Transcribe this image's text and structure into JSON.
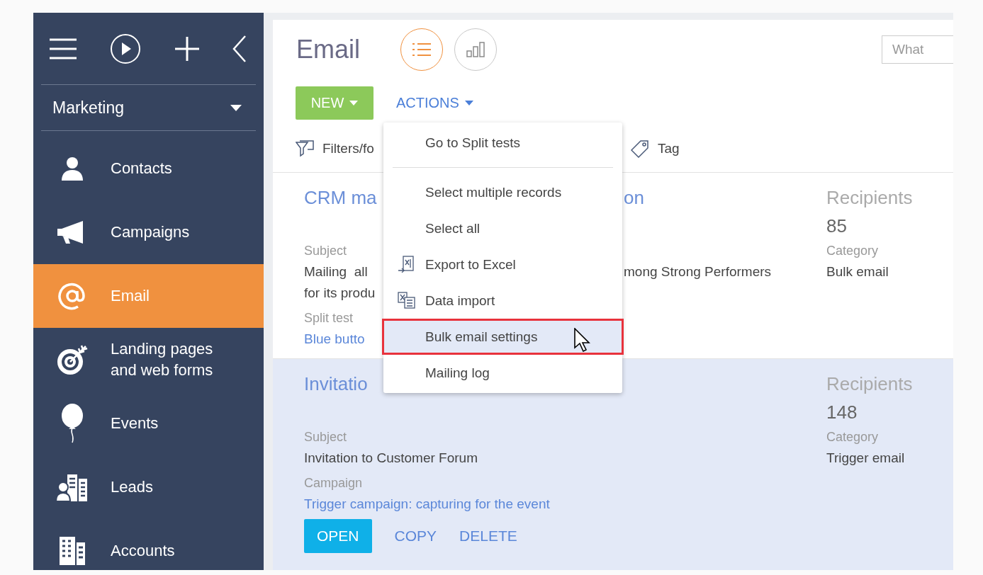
{
  "sidebar": {
    "section": "Marketing",
    "items": [
      {
        "label": "Contacts",
        "selected": false
      },
      {
        "label": "Campaigns",
        "selected": false
      },
      {
        "label": "Email",
        "selected": true
      },
      {
        "label": "Landing pages and web forms",
        "selected": false
      },
      {
        "label": "Events",
        "selected": false
      },
      {
        "label": "Leads",
        "selected": false
      },
      {
        "label": "Accounts",
        "selected": false
      }
    ]
  },
  "page": {
    "title": "Email",
    "views": [
      {
        "selected": true
      },
      {
        "selected": false
      }
    ],
    "search": {
      "placeholder": "What"
    },
    "new_button": "NEW",
    "actions_button": "ACTIONS",
    "toolbar": [
      {
        "label": "Filters/fo"
      },
      {
        "label": "Tag"
      }
    ]
  },
  "records": [
    {
      "selected": false,
      "title": "CRM ma",
      "title_tail": "on",
      "lines": [
        {
          "kind": "label",
          "text": "Subject"
        },
        {
          "kind": "value",
          "text": "Mailing  all",
          "tail": "mong Strong Performers"
        },
        {
          "kind": "value",
          "text": "for its produ"
        },
        {
          "kind": "label",
          "text": "Split test"
        },
        {
          "kind": "link",
          "text": "Blue butto"
        }
      ],
      "recipients_label": "Recipients",
      "recipients": "85",
      "category_label": "Category",
      "category": "Bulk email"
    },
    {
      "selected": true,
      "title": "Invitatio",
      "lines": [
        {
          "kind": "label",
          "text": "Subject"
        },
        {
          "kind": "value",
          "text": "Invitation to Customer Forum"
        },
        {
          "kind": "label",
          "text": "Campaign"
        },
        {
          "kind": "link",
          "text": "Trigger campaign: capturing for the event"
        }
      ],
      "recipients_label": "Recipients",
      "recipients": "148",
      "category_label": "Category",
      "category": "Trigger email",
      "actions": [
        "OPEN",
        "COPY",
        "DELETE"
      ]
    }
  ],
  "actions_menu": {
    "items": [
      {
        "label": "Go to Split tests",
        "kind": "plain",
        "separator_after": true,
        "selected": false
      },
      {
        "label": "Select multiple records",
        "kind": "plain",
        "separator_after": false,
        "selected": false
      },
      {
        "label": "Select all",
        "kind": "plain",
        "separator_after": false,
        "selected": false
      },
      {
        "label": "Export to Excel",
        "kind": "export",
        "separator_after": false,
        "selected": false
      },
      {
        "label": "Data import",
        "kind": "import",
        "separator_after": false,
        "selected": false
      },
      {
        "label": "Bulk email settings",
        "kind": "plain",
        "separator_after": false,
        "selected": true
      },
      {
        "label": "Mailing log",
        "kind": "plain",
        "separator_after": false,
        "selected": false
      }
    ]
  }
}
